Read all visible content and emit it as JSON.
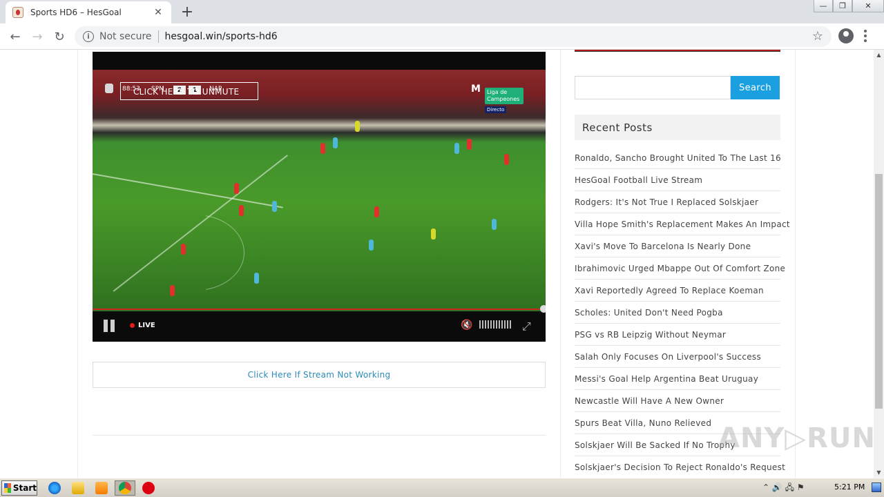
{
  "browser": {
    "tab_title": "Sports HD6 – HesGoal",
    "tab_close": "✕",
    "new_tab": "+",
    "nav_back": "←",
    "nav_forward": "→",
    "nav_reload": "↻",
    "security_label": "Not secure",
    "url": "hesgoal.win/sports-hd6",
    "bookmark_star": "☆",
    "window_min": "—",
    "window_restore": "❐",
    "window_close": "✕"
  },
  "player": {
    "overlay_text": "CLICK HERE TO UNMUTE",
    "score_clock": "88:53",
    "team_home": "SPM",
    "score_home": "2",
    "score_away": "1",
    "team_away": "NAP",
    "broadcaster_mark": "M",
    "broadcaster_tag": "Liga de Campeones",
    "broadcaster_sub": "Directo",
    "live_label": "LIVE",
    "mute_icon": "🔇",
    "fullscreen_icon": "⤢"
  },
  "content": {
    "stream_link": "Click Here If Stream Not Working"
  },
  "sidebar": {
    "search_placeholder": "",
    "search_button": "Search",
    "recent_title": "Recent Posts",
    "recent_posts": [
      "Ronaldo, Sancho Brought United To The Last 16",
      "HesGoal Football Live Stream",
      "Rodgers: It's Not True I Replaced Solskjaer",
      "Villa Hope Smith's Replacement Makes An Impact",
      "Xavi's Move To Barcelona Is Nearly Done",
      "Ibrahimovic Urged Mbappe Out Of Comfort Zone",
      "Xavi Reportedly Agreed To Replace Koeman",
      "Scholes: United Don't Need Pogba",
      "PSG vs RB Leipzig Without Neymar",
      "Salah Only Focuses On Liverpool's Success",
      "Messi's Goal Help Argentina Beat Uruguay",
      "Newcastle Will Have A New Owner",
      "Spurs Beat Villa, Nuno Relieved",
      "Solskjaer Will Be Sacked If No Trophy",
      "Solskjaer's Decision To Reject Ronaldo's Request"
    ]
  },
  "watermark": "ANY▷RUN",
  "taskbar": {
    "start_label": "Start",
    "tray_icons": "⌃ 🔊 🖧 ⚑",
    "clock": "5:21 PM"
  }
}
